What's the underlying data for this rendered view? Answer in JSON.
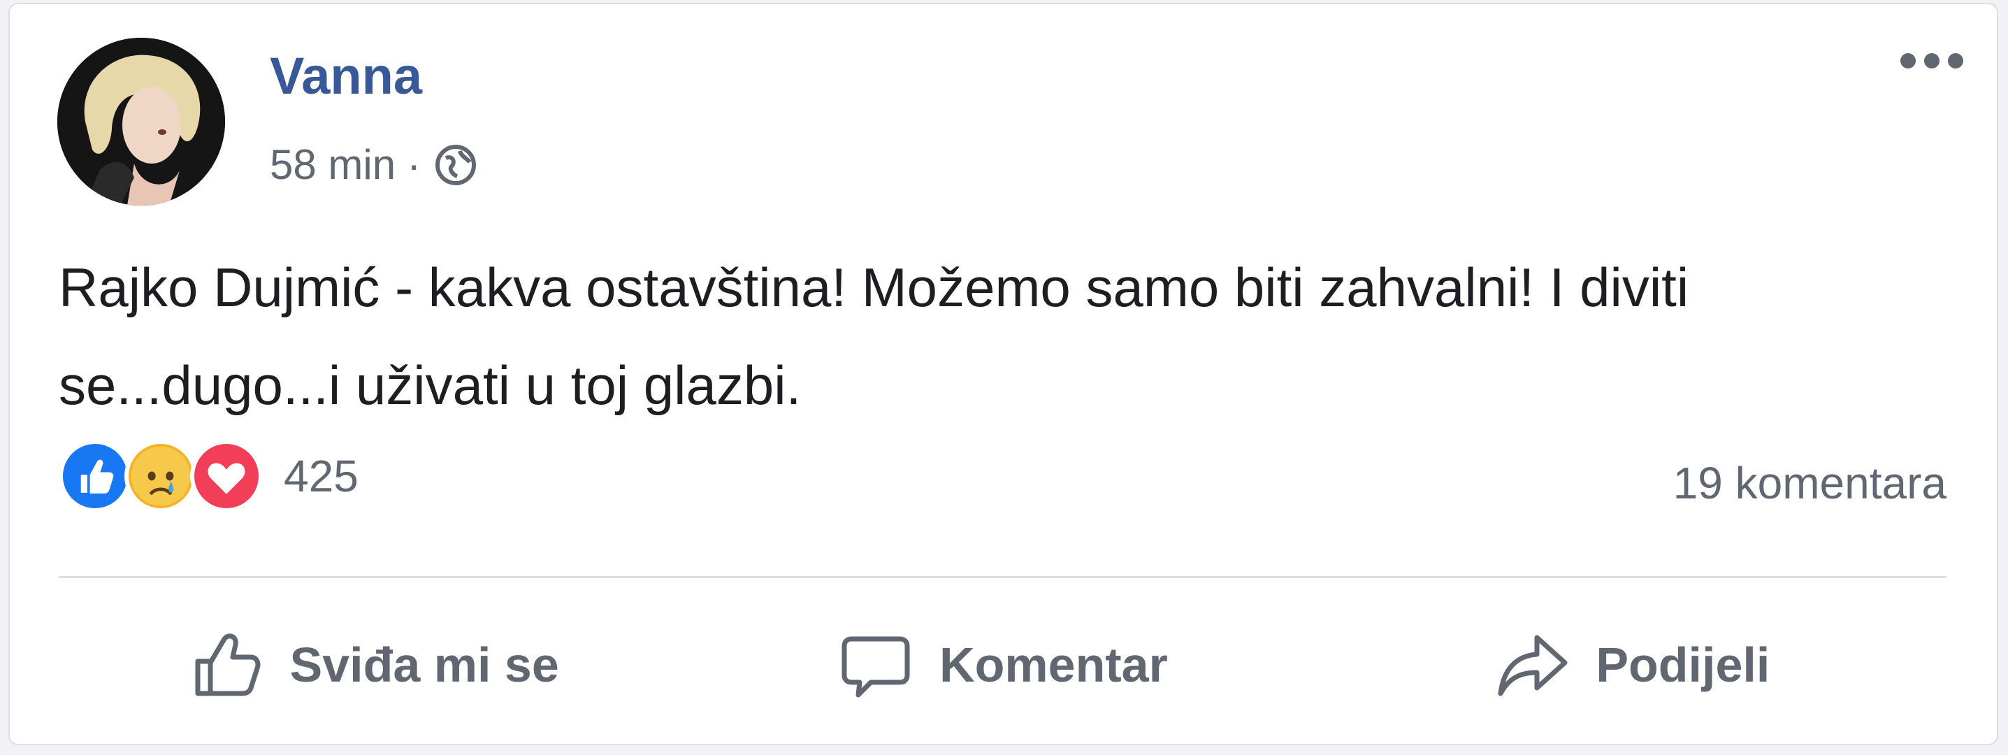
{
  "post": {
    "author": "Vanna",
    "time": "58 min",
    "separator": "·",
    "audience_icon": "globe-icon",
    "text": "Rajko Dujmić - kakva ostavština! Možemo samo biti zahvalni! I diviti se...dugo...i uživati u toj glazbi.",
    "reactions": {
      "icons": [
        "like-icon",
        "sad-icon",
        "love-icon"
      ],
      "count": "425"
    },
    "comments_count": "19 komentara"
  },
  "actions": {
    "like_label": "Sviđa mi se",
    "comment_label": "Komentar",
    "share_label": "Podijeli"
  },
  "colors": {
    "author": "#385898",
    "text": "#1c1e21",
    "muted": "#606770",
    "like": "#1877f2",
    "love": "#f33e58",
    "sad": "#f7b125"
  }
}
